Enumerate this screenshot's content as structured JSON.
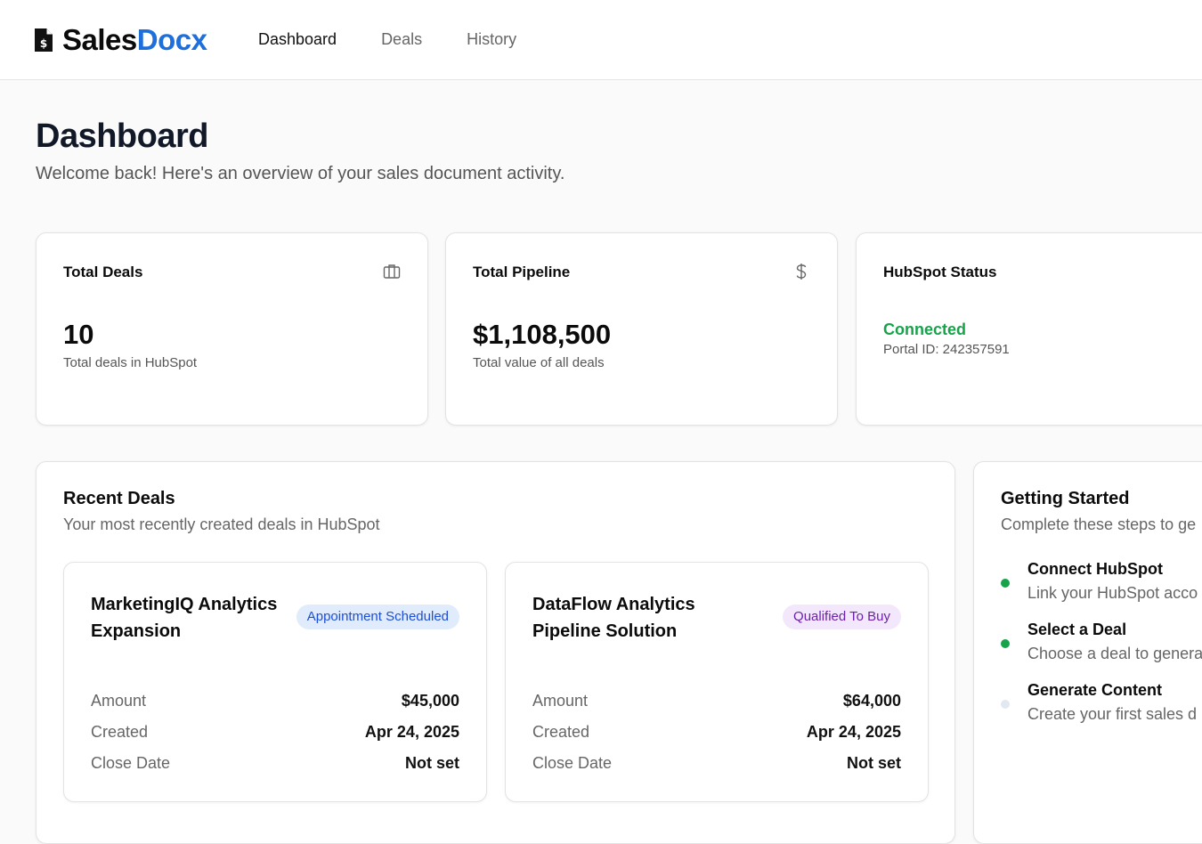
{
  "app": {
    "brand_main": "Sales",
    "brand_accent": "Docx",
    "accent_color": "#1e6fdc",
    "logo_icon": "file-dollar-icon"
  },
  "nav": {
    "items": [
      {
        "label": "Dashboard",
        "active": true
      },
      {
        "label": "Deals",
        "active": false
      },
      {
        "label": "History",
        "active": false
      }
    ]
  },
  "page": {
    "title": "Dashboard",
    "subtitle": "Welcome back! Here's an overview of your sales document activity."
  },
  "stats": {
    "total_deals": {
      "label": "Total Deals",
      "value": "10",
      "note": "Total deals in HubSpot",
      "icon": "briefcase-icon"
    },
    "total_pipeline": {
      "label": "Total Pipeline",
      "value": "$1,108,500",
      "note": "Total value of all deals",
      "icon": "dollar-icon"
    },
    "hubspot_status": {
      "label": "HubSpot Status",
      "value": "Connected",
      "note": "Portal ID: 242357591",
      "status_color": "#16a34a"
    }
  },
  "recent_deals": {
    "title": "Recent Deals",
    "subtitle": "Your most recently created deals in HubSpot",
    "deals": [
      {
        "name": "MarketingIQ Analytics Expansion",
        "stage": "Appointment Scheduled",
        "amount_label": "Amount",
        "amount": "$45,000",
        "created_label": "Created",
        "created": "Apr 24, 2025",
        "close_label": "Close Date",
        "close": "Not set"
      },
      {
        "name": "DataFlow Analytics Pipeline Solution",
        "stage": "Qualified To Buy",
        "amount_label": "Amount",
        "amount": "$64,000",
        "created_label": "Created",
        "created": "Apr 24, 2025",
        "close_label": "Close Date",
        "close": "Not set"
      }
    ]
  },
  "getting_started": {
    "title": "Getting Started",
    "subtitle": "Complete these steps to ge",
    "steps": [
      {
        "title": "Connect HubSpot",
        "desc": "Link your HubSpot acco",
        "done": true
      },
      {
        "title": "Select a Deal",
        "desc": "Choose a deal to genera",
        "done": true
      },
      {
        "title": "Generate Content",
        "desc": "Create your first sales d",
        "done": false
      }
    ]
  }
}
